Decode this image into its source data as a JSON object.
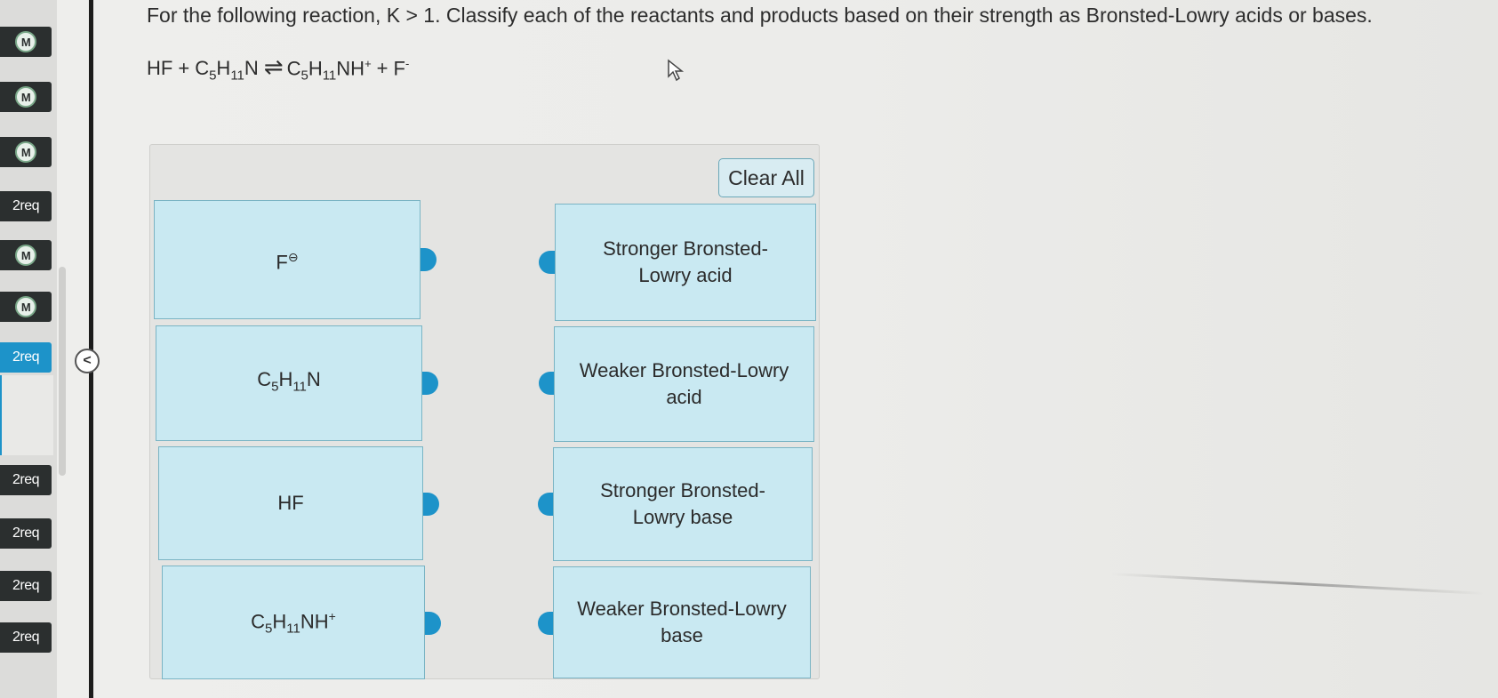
{
  "sidebar": {
    "items": [
      {
        "label": "M",
        "type": "badge"
      },
      {
        "label": "M",
        "type": "badge"
      },
      {
        "label": "M",
        "type": "badge"
      },
      {
        "label": "2req",
        "type": "text"
      },
      {
        "label": "M",
        "type": "badge"
      },
      {
        "label": "M",
        "type": "badge"
      },
      {
        "label": "2req",
        "type": "text",
        "active": true
      },
      {
        "label": "2req",
        "type": "text"
      },
      {
        "label": "2req",
        "type": "text"
      },
      {
        "label": "2req",
        "type": "text"
      },
      {
        "label": "2req",
        "type": "text"
      }
    ],
    "collapse_glyph": "<",
    "active_color": "#1d93c9"
  },
  "question": {
    "prompt": "For the following reaction, K > 1. Classify each of the reactants and products based on their strength as Bronsted-Lowry acids or bases.",
    "equation": {
      "hf": "HF",
      "plus1": "+",
      "amine_c": "C",
      "amine_c_sub": "5",
      "amine_h": "H",
      "amine_h_sub": "11",
      "amine_n": "N",
      "arrow": "⇌",
      "prod_c": "C",
      "prod_c_sub": "5",
      "prod_h": "H",
      "prod_h_sub": "11",
      "prod_nh": "NH",
      "prod_charge": "+",
      "plus2": "+",
      "fluoride": "F",
      "fluoride_charge": "-"
    }
  },
  "workspace": {
    "clear_all_label": "Clear All",
    "species": [
      {
        "base": "F",
        "charge": "⊖"
      },
      {
        "c": "C",
        "c_sub": "5",
        "h": "H",
        "h_sub": "11",
        "n": "N"
      },
      {
        "label": "HF"
      },
      {
        "c": "C",
        "c_sub": "5",
        "h": "H",
        "h_sub": "11",
        "n": "NH",
        "charge": "+"
      }
    ],
    "categories": [
      {
        "line1": "Stronger Bronsted-",
        "line2": "Lowry acid"
      },
      {
        "line1": "Weaker Bronsted-Lowry",
        "line2": "acid"
      },
      {
        "line1": "Stronger Bronsted-",
        "line2": "Lowry base"
      },
      {
        "line1": "Weaker Bronsted-Lowry",
        "line2": "base"
      }
    ],
    "colors": {
      "card_fill": "#c9e9f2",
      "card_border": "#7ab4c4",
      "connector": "#1d93c9"
    }
  }
}
